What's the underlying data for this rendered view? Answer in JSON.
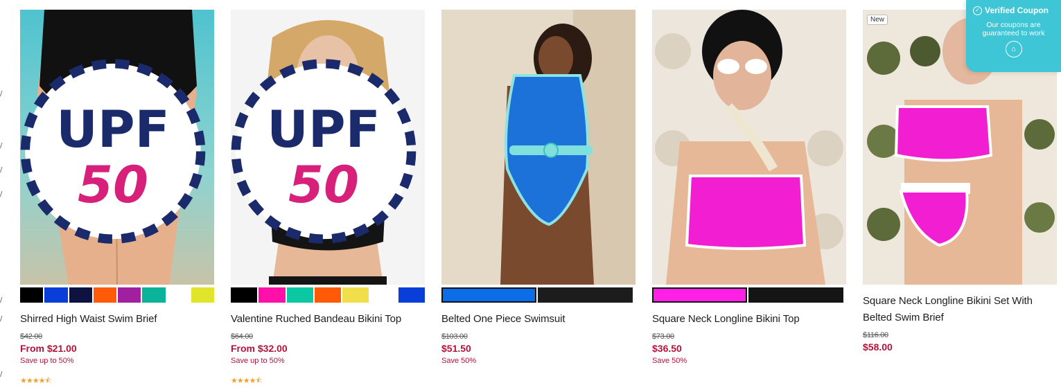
{
  "coupon": {
    "title": "Verified Coupon",
    "subtitle": "Our coupons are guaranteed to work",
    "icon": "check-circle-icon"
  },
  "products": [
    {
      "name": "Shirred High Waist Swim Brief",
      "original_price": "$42.00",
      "price": "From $21.00",
      "save": "Save up to 50%",
      "stars": "★★★★⯪",
      "rating": 4.5,
      "badge": "UPF 50",
      "swatches": [
        "#000000",
        "#0a3ed8",
        "#0d1240",
        "#ff5a08",
        "#a020a0",
        "#0bb39a",
        "#ffffff",
        "#e0e42a"
      ]
    },
    {
      "name": "Valentine Ruched Bandeau Bikini Top",
      "original_price": "$64.00",
      "price": "From $32.00",
      "save": "Save up to 50%",
      "stars": "★★★★⯪",
      "rating": 4.5,
      "badge": "UPF 50",
      "swatches": [
        "#000000",
        "#ff10a8",
        "#0bc7a2",
        "#ff5a08",
        "#f0df4a",
        "#ffffff",
        "#0a3ed8"
      ]
    },
    {
      "name": "Belted One Piece Swimsuit",
      "original_price": "$103.00",
      "price": "$51.50",
      "save": "Save 50%",
      "swatches": [
        "#0b6ee8",
        "#1c1c1c"
      ]
    },
    {
      "name": "Square Neck Longline Bikini Top",
      "original_price": "$73.00",
      "price": "$36.50",
      "save": "Save 50%",
      "swatches": [
        "#ff20e8",
        "#151515"
      ]
    },
    {
      "name": "Square Neck Longline Bikini Set With Belted Swim Brief",
      "original_price": "$116.00",
      "price": "$58.00",
      "badge": "New"
    }
  ]
}
